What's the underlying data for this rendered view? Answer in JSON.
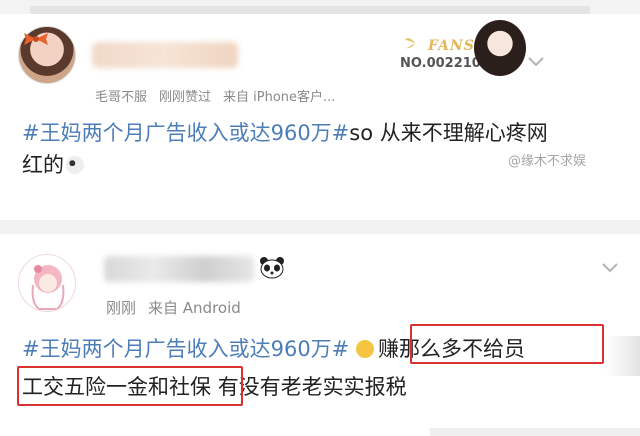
{
  "post1": {
    "meta": [
      "毛哥不服",
      "刚刚赞过",
      "来自 iPhone客户..."
    ],
    "fans_badge": {
      "label": "FANS",
      "number": "NO.0022102"
    },
    "hashtag": "#王妈两个月广告收入或达960万#",
    "text_after": "so 从来不理解心疼网",
    "text_line2": "红的",
    "watermark": "@缘木不求娱"
  },
  "post2": {
    "meta": [
      "刚刚",
      "来自 Android"
    ],
    "hashtag": "#王妈两个月广告收入或达960万#",
    "highlight_a": "赚那么多不给员",
    "highlight_b": "工交五险一金和社保",
    "text_after": "有没有老老实实报税"
  },
  "colors": {
    "hashtag": "#4d7eb7",
    "highlight_box": "#d93030",
    "meta": "#8a8a8a"
  }
}
